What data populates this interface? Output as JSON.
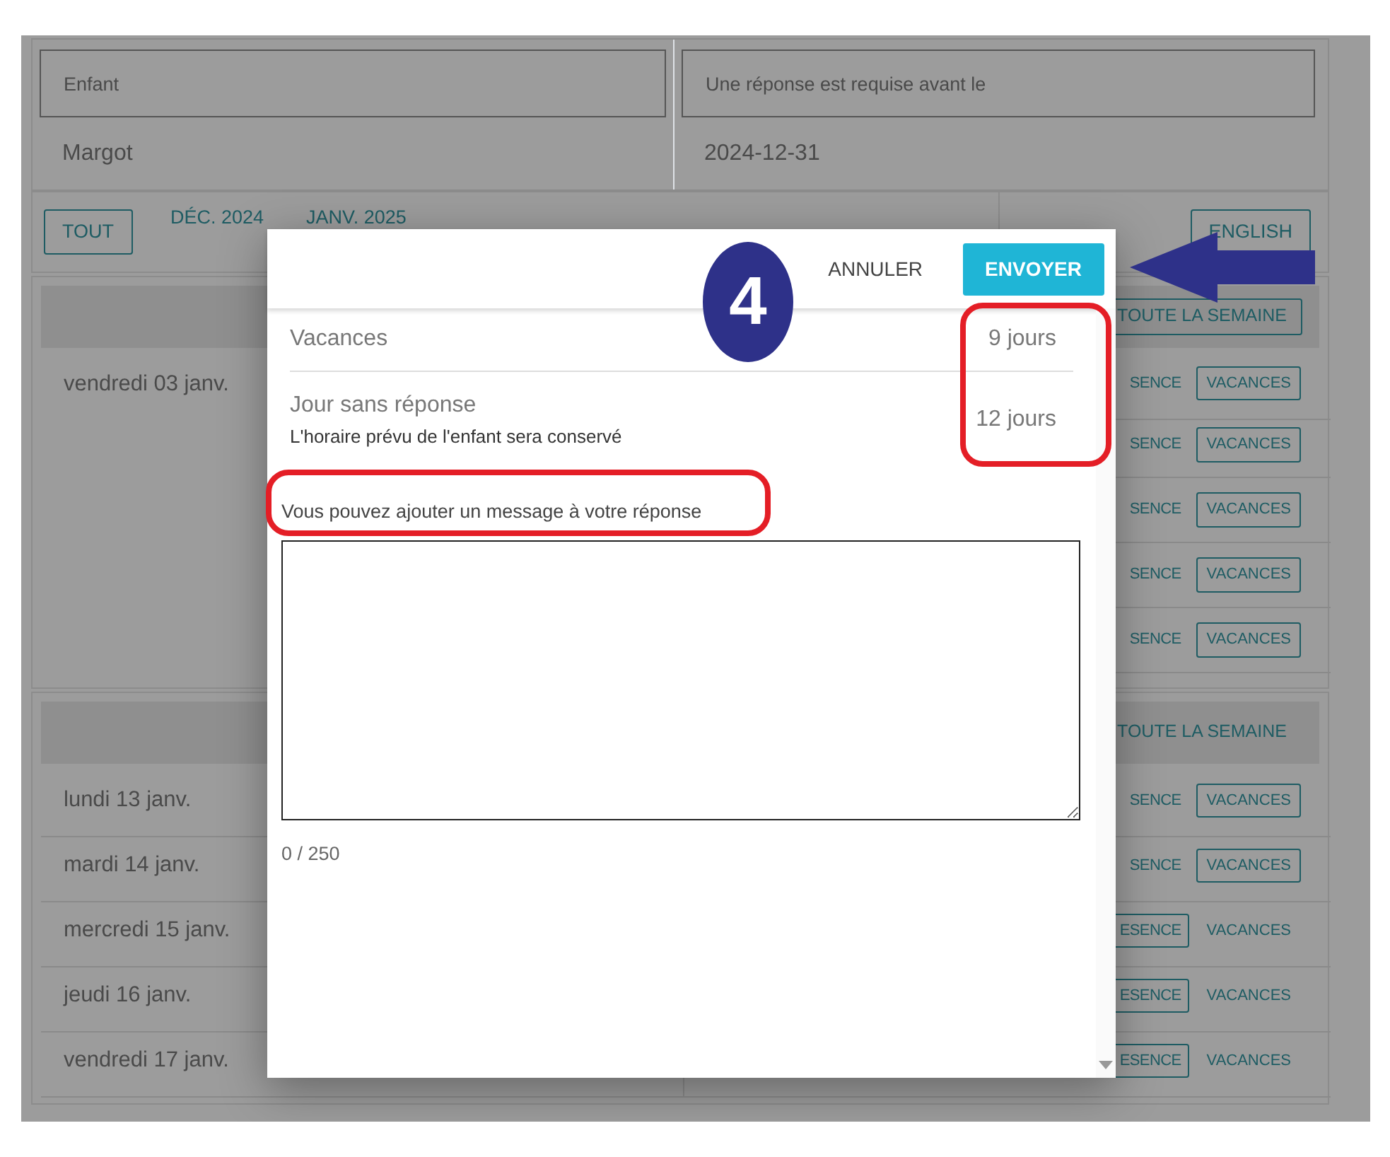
{
  "header": {
    "fields": [
      {
        "label": "Enfant",
        "value": "Margot"
      },
      {
        "label": "Une réponse est requise avant le",
        "value": "2024-12-31"
      }
    ]
  },
  "filters": [
    {
      "label": "TOUT",
      "selected": true
    },
    {
      "label": "DÉC. 2024",
      "selected": false
    },
    {
      "label": "JANV. 2025",
      "selected": false
    }
  ],
  "language_button": "ENGLISH",
  "weeks": [
    {
      "all_week": {
        "label": "TOUTE LA SEMAINE",
        "selected": true
      },
      "rows": [
        {
          "day": "vendredi 03 janv.",
          "presence": {
            "label": "SENCE",
            "selected": false
          },
          "vacation": {
            "label": "VACANCES",
            "selected": true
          }
        },
        {
          "presence": {
            "label": "SENCE",
            "selected": false
          },
          "vacation": {
            "label": "VACANCES",
            "selected": true
          }
        },
        {
          "presence": {
            "label": "SENCE",
            "selected": false
          },
          "vacation": {
            "label": "VACANCES",
            "selected": true
          }
        },
        {
          "presence": {
            "label": "SENCE",
            "selected": false
          },
          "vacation": {
            "label": "VACANCES",
            "selected": true
          }
        },
        {
          "presence": {
            "label": "SENCE",
            "selected": false
          },
          "vacation": {
            "label": "VACANCES",
            "selected": true
          }
        }
      ]
    },
    {
      "all_week": {
        "label": "TOUTE LA SEMAINE",
        "selected": false
      },
      "rows": [
        {
          "day": "lundi 13 janv.",
          "presence": {
            "label": "SENCE",
            "selected": false
          },
          "vacation": {
            "label": "VACANCES",
            "selected": true
          }
        },
        {
          "day": "mardi 14 janv.",
          "presence": {
            "label": "SENCE",
            "selected": false
          },
          "vacation": {
            "label": "VACANCES",
            "selected": true
          }
        },
        {
          "day": "mercredi 15 janv.",
          "presence": {
            "label": "ESENCE",
            "selected": true
          },
          "vacation": {
            "label": "VACANCES",
            "selected": false
          }
        },
        {
          "day": "jeudi 16 janv.",
          "presence": {
            "label": "ESENCE",
            "selected": true
          },
          "vacation": {
            "label": "VACANCES",
            "selected": false
          }
        },
        {
          "day": "vendredi 17 janv.",
          "presence": {
            "label": "ESENCE",
            "selected": true
          },
          "vacation": {
            "label": "VACANCES",
            "selected": false
          }
        }
      ]
    }
  ],
  "dialog": {
    "cancel": "ANNULER",
    "submit": "ENVOYER",
    "summary": [
      {
        "label": "Vacances",
        "value": "9 jours"
      },
      {
        "label": "Jour sans réponse",
        "note": "L'horaire prévu de l'enfant sera conservé",
        "value": "12 jours"
      }
    ],
    "message_label": "Vous pouvez ajouter un message à votre réponse",
    "counter": "0 / 250"
  },
  "step_badge": "4"
}
